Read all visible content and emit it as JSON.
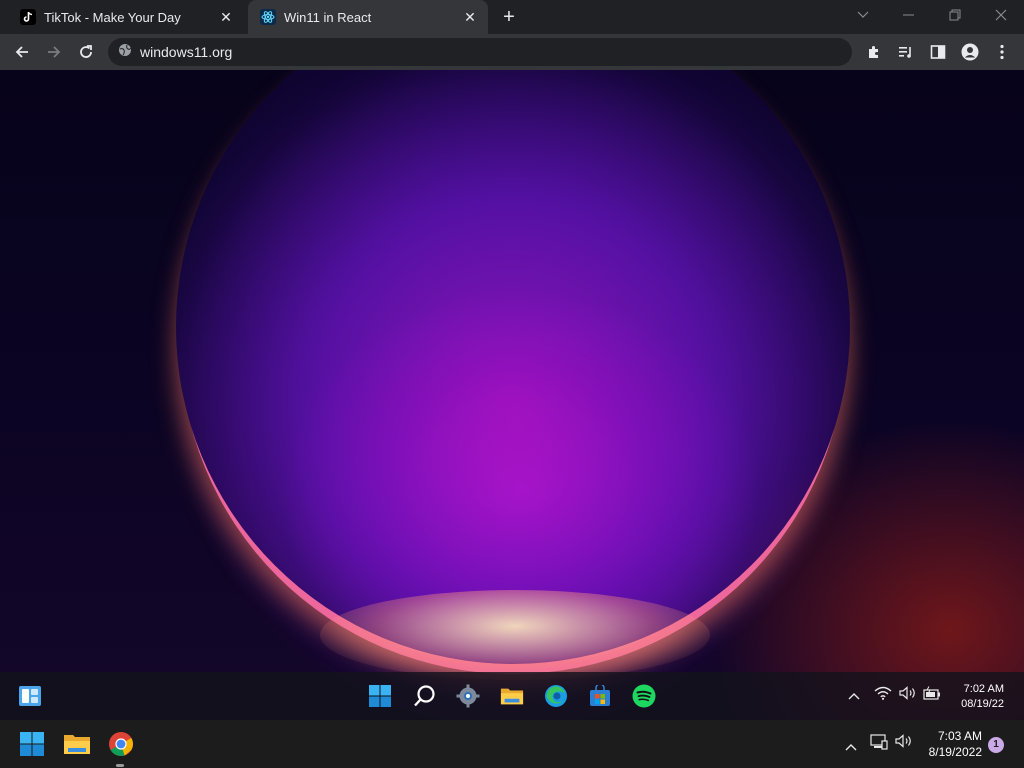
{
  "browser": {
    "tabs": [
      {
        "title": "TikTok - Make Your Day",
        "favicon": "tiktok-icon",
        "active": false
      },
      {
        "title": "Win11 in React",
        "favicon": "win11-react-icon",
        "active": true
      }
    ],
    "address": "windows11.org",
    "toolbar_icons": [
      "extensions-icon",
      "media-controls-icon",
      "side-panel-icon",
      "profile-icon",
      "menu-icon"
    ]
  },
  "web_taskbar": {
    "pinned": [
      "widgets-icon",
      "start-icon",
      "search-icon",
      "settings-icon",
      "file-explorer-icon",
      "edge-icon",
      "store-icon",
      "spotify-icon"
    ],
    "tray_icons": [
      "chevron-up-icon",
      "wifi-icon",
      "volume-icon",
      "battery-icon"
    ],
    "time": "7:02 AM",
    "date": "08/19/22"
  },
  "os_taskbar": {
    "apps": [
      "start-icon",
      "file-explorer-icon",
      "chrome-icon"
    ],
    "tray_icons": [
      "chevron-up-icon",
      "network-icon",
      "volume-icon"
    ],
    "time": "7:03 AM",
    "date": "8/19/2022",
    "notification_count": "1"
  },
  "colors": {
    "chrome_dark": "#202124",
    "chrome_toolbar": "#35363a",
    "win_accent": "#0a84d6",
    "spotify_green": "#1ed760",
    "wallpaper_magenta": "#b414c8"
  }
}
